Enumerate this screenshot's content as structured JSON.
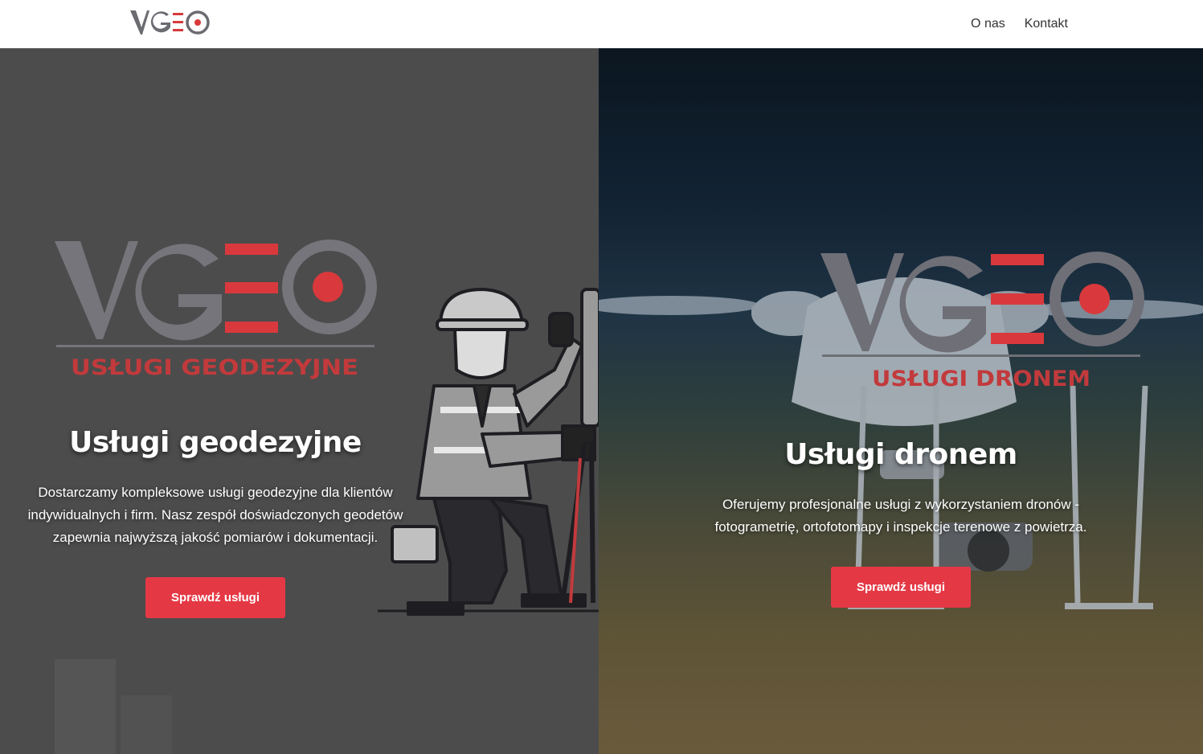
{
  "header": {
    "logo_text": "VGEO",
    "nav": [
      {
        "label": "O nas"
      },
      {
        "label": "Kontakt"
      }
    ]
  },
  "panels": {
    "geodesy": {
      "logo_text": "VGEO",
      "logo_subtitle": "USŁUGI GEODEZYJNE",
      "title": "Usługi geodezyjne",
      "description": "Dostarczamy kompleksowe usługi geodezyjne dla klientów indywidualnych i firm. Nasz zespół doświadczonych geodetów zapewnia najwyższą jakość pomiarów i dokumentacji.",
      "button_label": "Sprawdź usługi"
    },
    "drone": {
      "logo_text": "VGEO",
      "logo_subtitle": "USŁUGI DRONEM",
      "title": "Usługi dronem",
      "description": "Oferujemy profesjonalne usługi z wykorzystaniem dronów - fotogrametrię, ortofotomapy i inspekcje terenowe z powietrza.",
      "button_label": "Sprawdź usługi"
    }
  },
  "colors": {
    "accent": "#e53845",
    "logo_gray": "#6b6b72",
    "logo_red": "#d9393c"
  }
}
